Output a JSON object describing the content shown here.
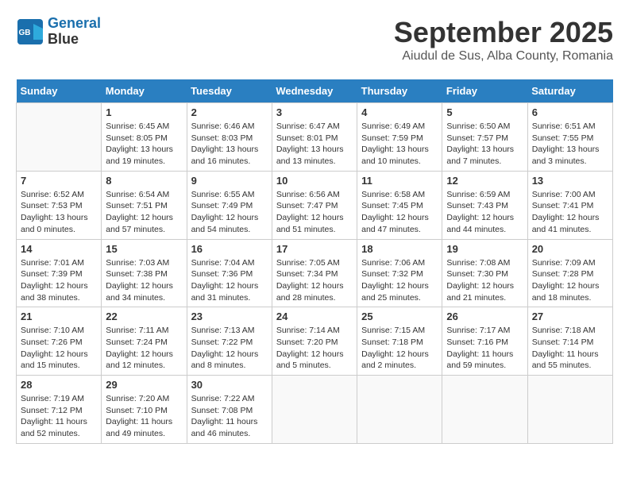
{
  "header": {
    "logo_line1": "General",
    "logo_line2": "Blue",
    "month_title": "September 2025",
    "location": "Aiudul de Sus, Alba County, Romania"
  },
  "weekdays": [
    "Sunday",
    "Monday",
    "Tuesday",
    "Wednesday",
    "Thursday",
    "Friday",
    "Saturday"
  ],
  "weeks": [
    [
      {
        "day": "",
        "info": ""
      },
      {
        "day": "1",
        "info": "Sunrise: 6:45 AM\nSunset: 8:05 PM\nDaylight: 13 hours\nand 19 minutes."
      },
      {
        "day": "2",
        "info": "Sunrise: 6:46 AM\nSunset: 8:03 PM\nDaylight: 13 hours\nand 16 minutes."
      },
      {
        "day": "3",
        "info": "Sunrise: 6:47 AM\nSunset: 8:01 PM\nDaylight: 13 hours\nand 13 minutes."
      },
      {
        "day": "4",
        "info": "Sunrise: 6:49 AM\nSunset: 7:59 PM\nDaylight: 13 hours\nand 10 minutes."
      },
      {
        "day": "5",
        "info": "Sunrise: 6:50 AM\nSunset: 7:57 PM\nDaylight: 13 hours\nand 7 minutes."
      },
      {
        "day": "6",
        "info": "Sunrise: 6:51 AM\nSunset: 7:55 PM\nDaylight: 13 hours\nand 3 minutes."
      }
    ],
    [
      {
        "day": "7",
        "info": "Sunrise: 6:52 AM\nSunset: 7:53 PM\nDaylight: 13 hours\nand 0 minutes."
      },
      {
        "day": "8",
        "info": "Sunrise: 6:54 AM\nSunset: 7:51 PM\nDaylight: 12 hours\nand 57 minutes."
      },
      {
        "day": "9",
        "info": "Sunrise: 6:55 AM\nSunset: 7:49 PM\nDaylight: 12 hours\nand 54 minutes."
      },
      {
        "day": "10",
        "info": "Sunrise: 6:56 AM\nSunset: 7:47 PM\nDaylight: 12 hours\nand 51 minutes."
      },
      {
        "day": "11",
        "info": "Sunrise: 6:58 AM\nSunset: 7:45 PM\nDaylight: 12 hours\nand 47 minutes."
      },
      {
        "day": "12",
        "info": "Sunrise: 6:59 AM\nSunset: 7:43 PM\nDaylight: 12 hours\nand 44 minutes."
      },
      {
        "day": "13",
        "info": "Sunrise: 7:00 AM\nSunset: 7:41 PM\nDaylight: 12 hours\nand 41 minutes."
      }
    ],
    [
      {
        "day": "14",
        "info": "Sunrise: 7:01 AM\nSunset: 7:39 PM\nDaylight: 12 hours\nand 38 minutes."
      },
      {
        "day": "15",
        "info": "Sunrise: 7:03 AM\nSunset: 7:38 PM\nDaylight: 12 hours\nand 34 minutes."
      },
      {
        "day": "16",
        "info": "Sunrise: 7:04 AM\nSunset: 7:36 PM\nDaylight: 12 hours\nand 31 minutes."
      },
      {
        "day": "17",
        "info": "Sunrise: 7:05 AM\nSunset: 7:34 PM\nDaylight: 12 hours\nand 28 minutes."
      },
      {
        "day": "18",
        "info": "Sunrise: 7:06 AM\nSunset: 7:32 PM\nDaylight: 12 hours\nand 25 minutes."
      },
      {
        "day": "19",
        "info": "Sunrise: 7:08 AM\nSunset: 7:30 PM\nDaylight: 12 hours\nand 21 minutes."
      },
      {
        "day": "20",
        "info": "Sunrise: 7:09 AM\nSunset: 7:28 PM\nDaylight: 12 hours\nand 18 minutes."
      }
    ],
    [
      {
        "day": "21",
        "info": "Sunrise: 7:10 AM\nSunset: 7:26 PM\nDaylight: 12 hours\nand 15 minutes."
      },
      {
        "day": "22",
        "info": "Sunrise: 7:11 AM\nSunset: 7:24 PM\nDaylight: 12 hours\nand 12 minutes."
      },
      {
        "day": "23",
        "info": "Sunrise: 7:13 AM\nSunset: 7:22 PM\nDaylight: 12 hours\nand 8 minutes."
      },
      {
        "day": "24",
        "info": "Sunrise: 7:14 AM\nSunset: 7:20 PM\nDaylight: 12 hours\nand 5 minutes."
      },
      {
        "day": "25",
        "info": "Sunrise: 7:15 AM\nSunset: 7:18 PM\nDaylight: 12 hours\nand 2 minutes."
      },
      {
        "day": "26",
        "info": "Sunrise: 7:17 AM\nSunset: 7:16 PM\nDaylight: 11 hours\nand 59 minutes."
      },
      {
        "day": "27",
        "info": "Sunrise: 7:18 AM\nSunset: 7:14 PM\nDaylight: 11 hours\nand 55 minutes."
      }
    ],
    [
      {
        "day": "28",
        "info": "Sunrise: 7:19 AM\nSunset: 7:12 PM\nDaylight: 11 hours\nand 52 minutes."
      },
      {
        "day": "29",
        "info": "Sunrise: 7:20 AM\nSunset: 7:10 PM\nDaylight: 11 hours\nand 49 minutes."
      },
      {
        "day": "30",
        "info": "Sunrise: 7:22 AM\nSunset: 7:08 PM\nDaylight: 11 hours\nand 46 minutes."
      },
      {
        "day": "",
        "info": ""
      },
      {
        "day": "",
        "info": ""
      },
      {
        "day": "",
        "info": ""
      },
      {
        "day": "",
        "info": ""
      }
    ]
  ]
}
